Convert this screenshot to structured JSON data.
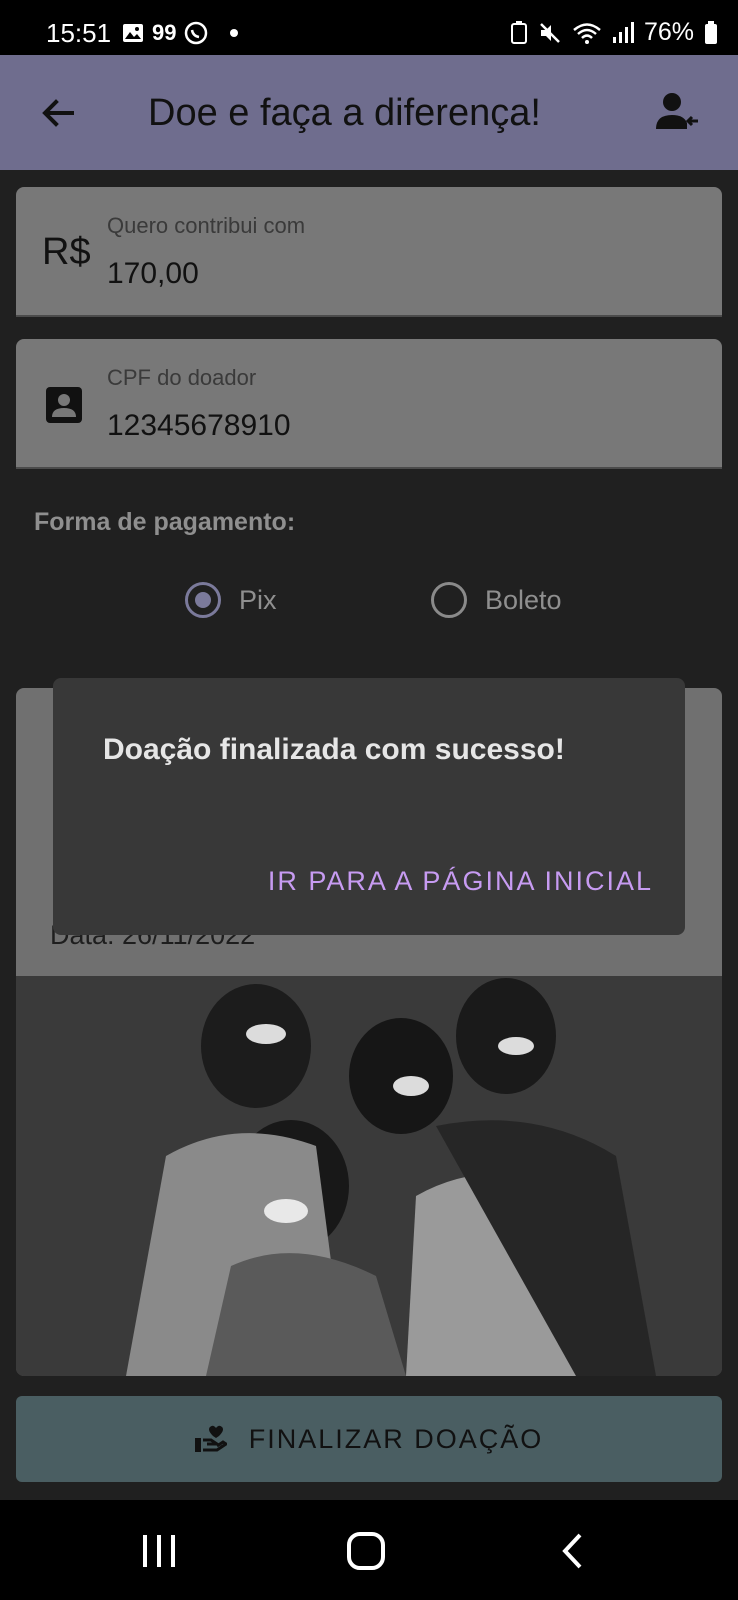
{
  "status": {
    "time": "15:51",
    "notif_badge": "99",
    "battery": "76%"
  },
  "appbar": {
    "title": "Doe e faça a diferença!"
  },
  "amount_field": {
    "prefix": "R$",
    "label": "Quero contribui com",
    "value": "170,00"
  },
  "cpf_field": {
    "label": "CPF do doador",
    "value": "12345678910"
  },
  "payment": {
    "label": "Forma de pagamento:",
    "options": [
      {
        "label": "Pix",
        "selected": true
      },
      {
        "label": "Boleto",
        "selected": false
      }
    ]
  },
  "card": {
    "date_line": "Data: 26/11/2022"
  },
  "finalize_button": {
    "label": "FINALIZAR DOAÇÃO"
  },
  "dialog": {
    "message": "Doação finalizada com sucesso!",
    "action": "IR PARA A PÁGINA INICIAL"
  },
  "colors": {
    "app_bar": "#6f6d8e",
    "accent": "#c79bf2",
    "button": "#4a5e62"
  }
}
